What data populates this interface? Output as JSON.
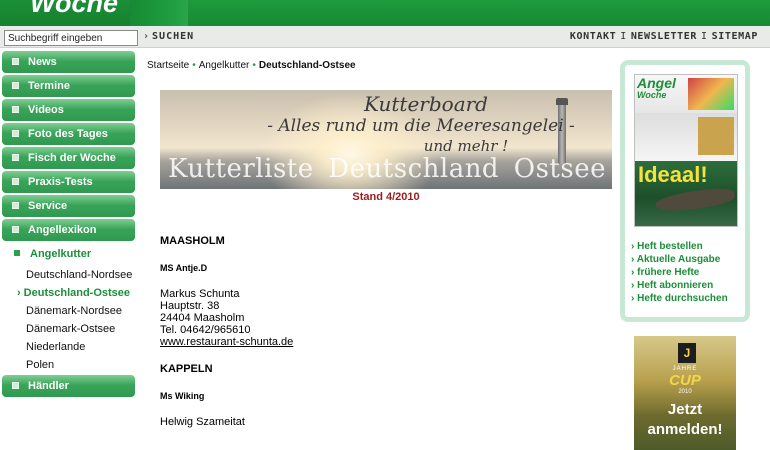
{
  "header": {
    "logo_text": "Woche"
  },
  "search": {
    "placeholder": "Suchbegriff eingeben",
    "value": "Suchbegriff eingeben",
    "button_label": "SUCHEN"
  },
  "top_links": [
    "KONTAKT",
    "NEWSLETTER",
    "SITEMAP"
  ],
  "sidebar": {
    "main_items": [
      {
        "label": "News"
      },
      {
        "label": "Termine"
      },
      {
        "label": "Videos"
      },
      {
        "label": "Foto des Tages"
      },
      {
        "label": "Fisch der Woche"
      },
      {
        "label": "Praxis-Tests"
      },
      {
        "label": "Service"
      },
      {
        "label": "Angellexikon"
      }
    ],
    "active_item": {
      "label": "Angelkutter"
    },
    "sub_items": [
      {
        "label": "Deutschland-Nordsee"
      },
      {
        "label": "Deutschland-Ostsee"
      },
      {
        "label": "Dänemark-Nordsee"
      },
      {
        "label": "Dänemark-Ostsee"
      },
      {
        "label": "Niederlande"
      },
      {
        "label": "Polen"
      }
    ],
    "last_item": {
      "label": "Händler"
    }
  },
  "breadcrumb": {
    "items": [
      "Startseite",
      "Angelkutter",
      "Deutschland-Ostsee"
    ]
  },
  "banner": {
    "line1": "Kutterboard",
    "line2": "- Alles rund um die Meeresangelei -",
    "line3": "und mehr !",
    "words": [
      "Kutterliste",
      "Deutschland",
      "Ostsee"
    ],
    "stand": "Stand 4/2010"
  },
  "listing": {
    "region1": "MAASHOLM",
    "boat1": "MS Antje.D",
    "addr1": [
      "Markus Schunta",
      "Hauptstr. 38",
      "24404 Maasholm",
      "Tel. 04642/965610"
    ],
    "link1": "www.restaurant-schunta.de",
    "region2": "KAPPELN",
    "boat2": "Ms Wiking",
    "addr2": [
      "Helwig Szameitat"
    ]
  },
  "magazine": {
    "cover_title": "Angel",
    "cover_subtitle": "Woche",
    "cover_headline": "Ideaal!",
    "links": [
      "Heft bestellen",
      "Aktuelle Ausgabe",
      "frühere Hefte",
      "Heft abonnieren",
      "Hefte durchsuchen"
    ]
  },
  "promo": {
    "badge": "J",
    "label": "JAHRE",
    "cup": "CUP",
    "year": "2010",
    "cta_line1": "Jetzt",
    "cta_line2": "anmelden!"
  },
  "colors": {
    "header_green": "#1f9a3d",
    "nav_green": "#3aa55a",
    "link_green": "#1d8e3b",
    "stand_red": "#9b1c1c"
  }
}
